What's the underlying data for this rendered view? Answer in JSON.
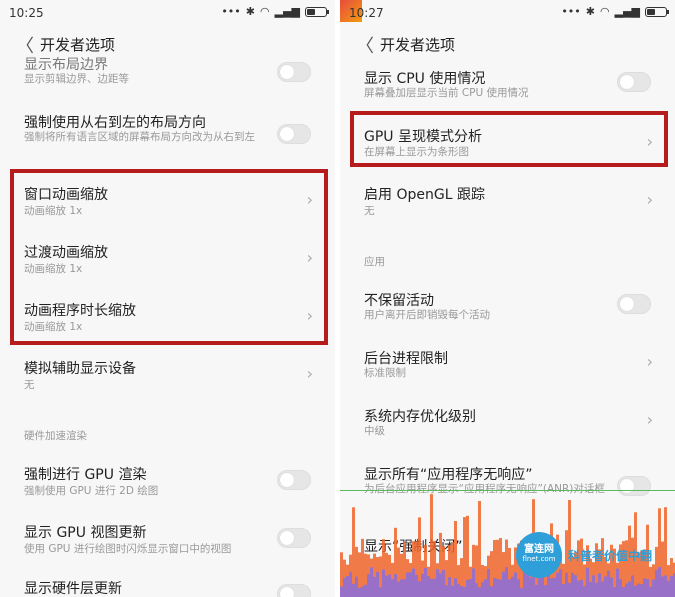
{
  "left": {
    "status": {
      "time": "10:25"
    },
    "title": "开发者选项",
    "rows": [
      {
        "title": "显示布局边界",
        "subtitle": "显示剪辑边界、边距等"
      },
      {
        "title": "强制使用从右到左的布局方向",
        "subtitle": "强制将所有语言区域的屏幕布局方向改为从右到左"
      },
      {
        "title": "窗口动画缩放",
        "subtitle": "动画缩放 1x"
      },
      {
        "title": "过渡动画缩放",
        "subtitle": "动画缩放 1x"
      },
      {
        "title": "动画程序时长缩放",
        "subtitle": "动画缩放 1x"
      },
      {
        "title": "模拟辅助显示设备",
        "subtitle": "无"
      },
      {
        "title": "强制进行 GPU 渲染",
        "subtitle": "强制使用 GPU 进行 2D 绘图"
      },
      {
        "title": "显示 GPU 视图更新",
        "subtitle": "使用 GPU 进行绘图时闪烁显示窗口中的视图"
      },
      {
        "title": "显示硬件层更新",
        "subtitle": ""
      }
    ],
    "section_hw": "硬件加速渲染"
  },
  "right": {
    "status": {
      "time": "10:27"
    },
    "title": "开发者选项",
    "rows": [
      {
        "title": "显示 CPU 使用情况",
        "subtitle": "屏幕叠加层显示当前 CPU 使用情况"
      },
      {
        "title": "GPU 呈现模式分析",
        "subtitle": "在屏幕上显示为条形图"
      },
      {
        "title": "启用 OpenGL 跟踪",
        "subtitle": "无"
      },
      {
        "title": "不保留活动",
        "subtitle": "用户离开后即销毁每个活动"
      },
      {
        "title": "后台进程限制",
        "subtitle": "标准限制"
      },
      {
        "title": "系统内存优化级别",
        "subtitle": "中级"
      },
      {
        "title": "显示所有“应用程序无响应”",
        "subtitle": "为后台应用程序显示“应用程序无响应”(ANR)对话框"
      },
      {
        "title": "显示“强制关闭”",
        "subtitle": ""
      }
    ],
    "section_apps": "应用"
  },
  "watermark": {
    "logo_top": "富连网",
    "logo_bottom": "flnet.com",
    "text": "科普者价值中翻"
  },
  "colors": {
    "highlight": "#b71c1c",
    "graph_orange": "#f0642a",
    "graph_purple": "#8e6fd6",
    "graph_green": "#5cb85c"
  }
}
